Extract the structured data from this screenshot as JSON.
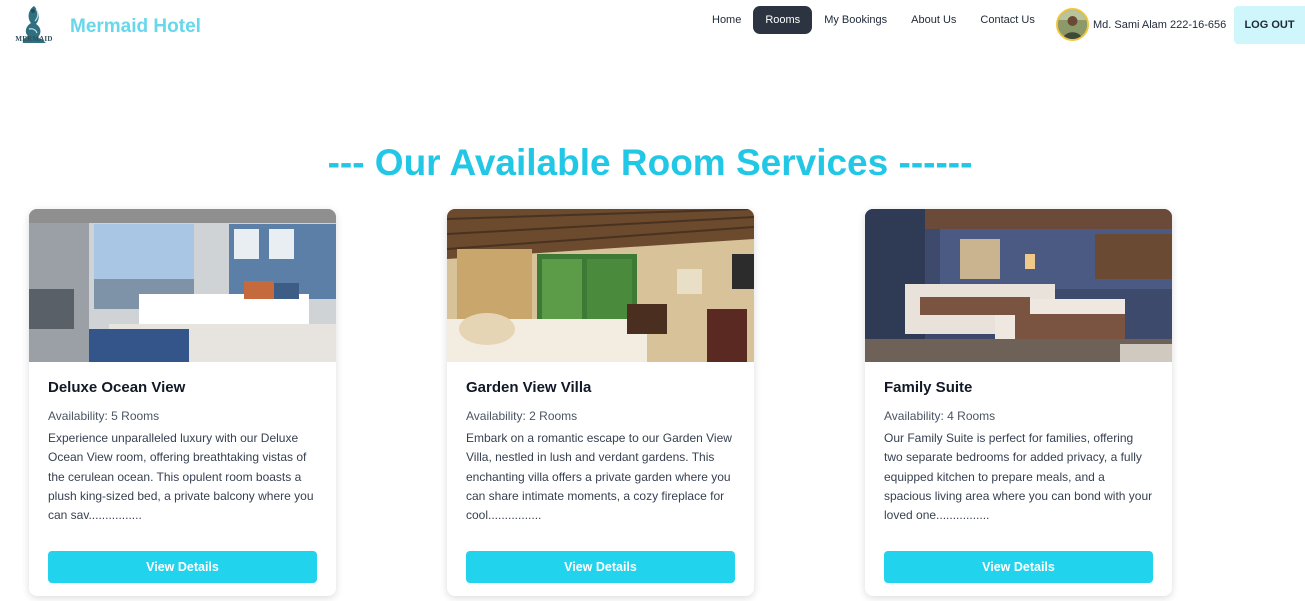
{
  "brand": {
    "name": "Mermaid Hotel",
    "logo_text": "MERMAID",
    "logo_icon": "mermaid-logo-icon"
  },
  "nav": {
    "items": [
      {
        "label": "Home",
        "active": false
      },
      {
        "label": "Rooms",
        "active": true
      },
      {
        "label": "My Bookings",
        "active": false
      },
      {
        "label": "About Us",
        "active": false
      },
      {
        "label": "Contact Us",
        "active": false
      }
    ],
    "user_name": "Md. Sami Alam 222-16-656",
    "logout_label": "LOG OUT"
  },
  "section": {
    "title": "--- Our Available Room Services ------"
  },
  "rooms": [
    {
      "title": "Deluxe Ocean View",
      "availability": "Availability: 5 Rooms",
      "description": "Experience unparalleled luxury with our Deluxe Ocean View room, offering breathtaking vistas of the cerulean ocean. This opulent room boasts a plush king-sized bed, a private balcony where you can sav................",
      "button": "View Details"
    },
    {
      "title": "Garden View Villa",
      "availability": "Availability: 2 Rooms",
      "description": "Embark on a romantic escape to our Garden View Villa, nestled in lush and verdant gardens. This enchanting villa offers a private garden where you can share intimate moments, a cozy fireplace for cool................",
      "button": "View Details"
    },
    {
      "title": "Family Suite",
      "availability": "Availability: 4 Rooms",
      "description": "Our Family Suite is perfect for families, offering two separate bedrooms for added privacy, a fully equipped kitchen to prepare meals, and a spacious living area where you can bond with your loved one................",
      "button": "View Details"
    }
  ],
  "colors": {
    "brand": "#67d7ec",
    "heading": "#22c7e6",
    "button": "#22d3ee",
    "active_nav": "#2b3440",
    "logout_bg": "#cff6fb"
  }
}
